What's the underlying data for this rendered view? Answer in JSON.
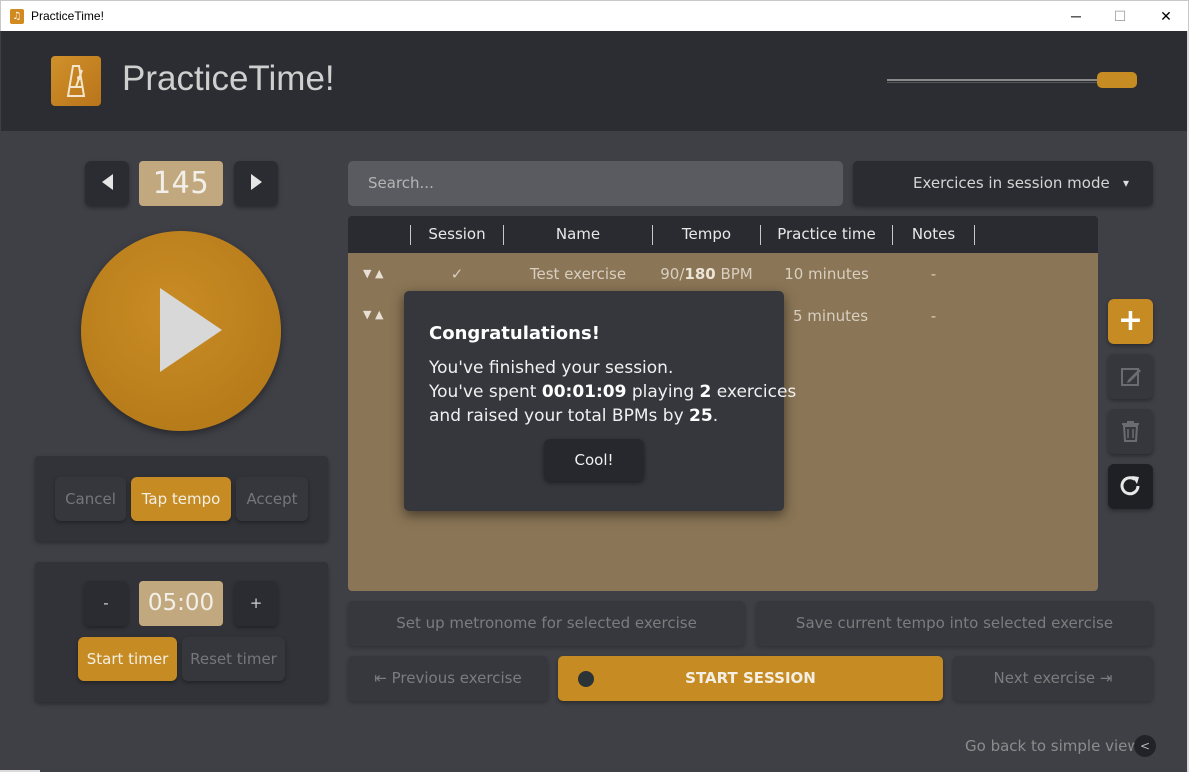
{
  "window": {
    "title": "PracticeTime!",
    "icon_glyph": "♫",
    "minimize": "─",
    "maximize": "☐",
    "close": "✕"
  },
  "header": {
    "app_title": "PracticeTime!",
    "volume_level": 0.95,
    "logo_icon": "metronome-icon"
  },
  "metronome": {
    "bpm": "145",
    "tap_panel": {
      "cancel": "Cancel",
      "tap_tempo": "Tap tempo",
      "accept": "Accept"
    },
    "timer": {
      "minus": "-",
      "value": "05:00",
      "plus": "+",
      "start": "Start timer",
      "reset": "Reset timer"
    }
  },
  "search": {
    "placeholder": "Search..."
  },
  "mode_select": {
    "value": "Exercices in session mode",
    "chevron": "▾"
  },
  "table": {
    "columns": [
      "Session",
      "Name",
      "Tempo",
      "Practice time",
      "Notes"
    ],
    "rows": [
      {
        "session": "✓",
        "name": "Test exercise",
        "tempo_current": "90/",
        "tempo_target": "180",
        "tempo_unit": " BPM",
        "practice_time": "10 minutes",
        "notes": "-"
      },
      {
        "session": "",
        "name": "",
        "tempo_current": "",
        "tempo_target": "",
        "tempo_unit": "",
        "practice_time": "5 minutes",
        "notes": "-"
      }
    ],
    "row_arrows": "▼ ▲"
  },
  "side_actions": {
    "add": "+",
    "edit_icon": "edit-icon",
    "delete_icon": "trash-icon",
    "refresh_icon": "refresh-icon"
  },
  "modal": {
    "title": "Congratulations!",
    "line1": "You've finished your session.",
    "line2_pre": "You've spent ",
    "line2_time": "00:01:09",
    "line2_mid": " playing ",
    "line2_count": "2",
    "line2_post": " exercices",
    "line3_pre": "and raised your total BPMs by ",
    "line3_value": "25",
    "line3_post": ".",
    "button": "Cool!"
  },
  "bottom_actions": {
    "setup": "Set up metronome for selected exercise",
    "save": "Save current tempo into selected exercise",
    "previous": "⇤ Previous exercise",
    "start_session": "START SESSION",
    "next": "Next exercise ⇥"
  },
  "footer": {
    "simple_view": "Go back to simple view",
    "simple_view_btn": "<"
  },
  "colors": {
    "accent": "#c68b22",
    "background": "#3f4046",
    "header": "#2c2d32",
    "table_body": "#8a7556"
  }
}
